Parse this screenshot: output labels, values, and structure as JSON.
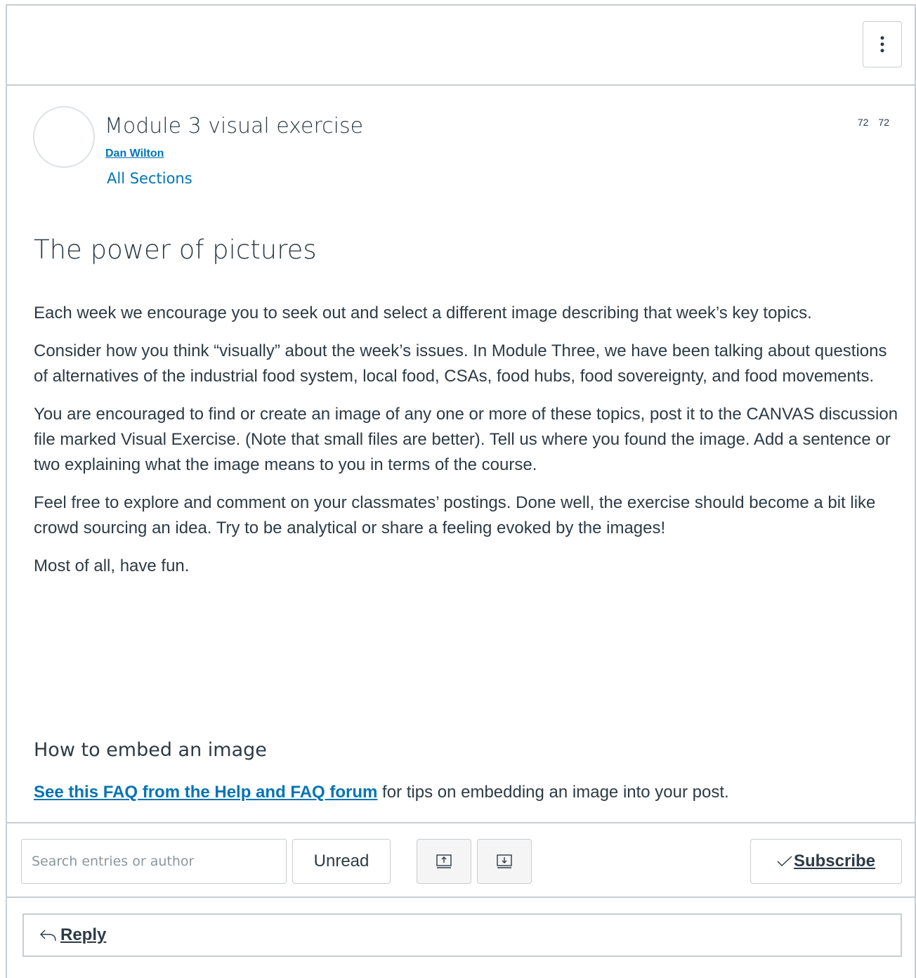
{
  "toolbar_top": {
    "menu_icon": "kebab-vertical-icon"
  },
  "topic": {
    "title": "Module 3 visual exercise",
    "author": "Dan Wilton",
    "sections": "All Sections",
    "count_a": "72",
    "count_b": "72"
  },
  "post": {
    "title": "The power of pictures",
    "paragraphs": [
      "Each week we encourage you to seek out and select a different image describing that week’s key topics.",
      "Consider how you think “visually” about the week’s issues. In Module Three, we have been talking about questions of alternatives of the industrial food system, local food, CSAs, food hubs, food sovereignty, and food movements.",
      "You are encouraged to find or create an image of any one or more of these topics, post it to the CANVAS discussion file marked Visual Exercise. (Note that small files are better). Tell us where you found the image. Add a sentence or two explaining what the image means to you in terms of the course.",
      "Feel free to explore and comment on your classmates’ postings. Done well, the exercise should become a bit like crowd sourcing an idea. Try to be analytical or share a feeling evoked by the images!",
      "Most of all, have fun."
    ],
    "subheading": "How to embed an image",
    "faq_link": "See this FAQ from the Help and FAQ forum",
    "faq_rest": " for tips on embedding an image into your post."
  },
  "controls": {
    "search_placeholder": "Search entries or author",
    "unread_label": "Unread",
    "sort_up_icon": "sort-ascending-icon",
    "sort_down_icon": "sort-descending-icon",
    "subscribe_label": "Subscribe",
    "subscribe_icon": "checkmark-icon"
  },
  "reply": {
    "label": "Reply",
    "icon": "reply-arrow-icon"
  }
}
